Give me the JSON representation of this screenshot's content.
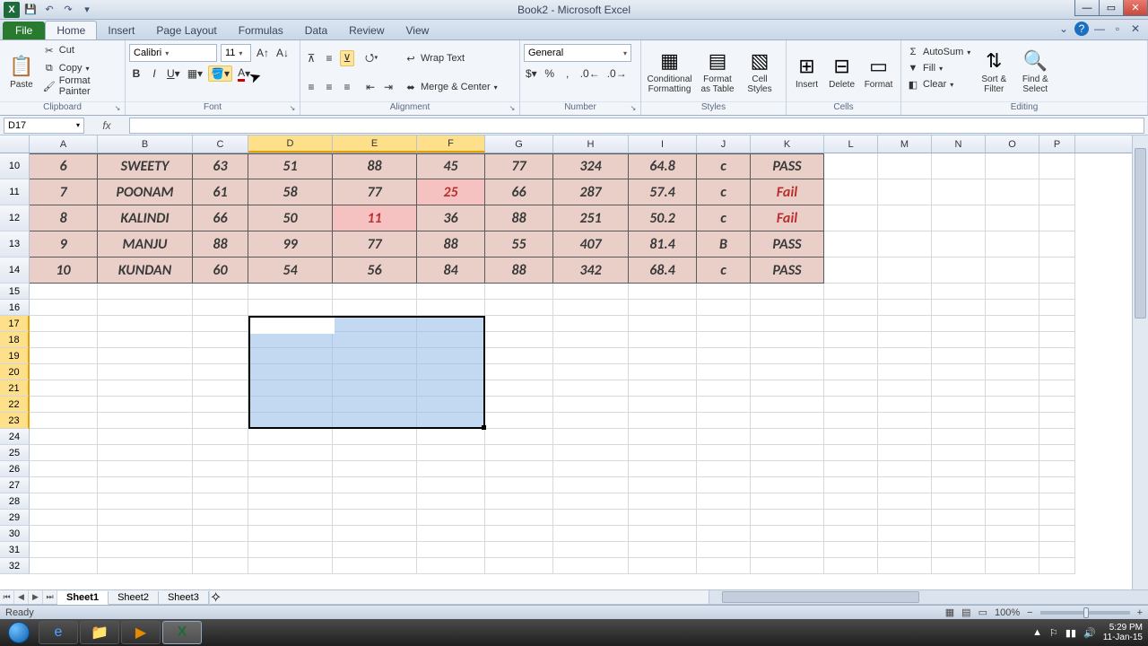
{
  "window": {
    "title": "Book2 - Microsoft Excel"
  },
  "tabs": [
    "File",
    "Home",
    "Insert",
    "Page Layout",
    "Formulas",
    "Data",
    "Review",
    "View"
  ],
  "active_tab": "Home",
  "ribbon": {
    "clipboard": {
      "paste": "Paste",
      "cut": "Cut",
      "copy": "Copy",
      "fp": "Format Painter",
      "label": "Clipboard"
    },
    "font": {
      "name": "Calibri",
      "size": "11",
      "label": "Font"
    },
    "alignment": {
      "wrap": "Wrap Text",
      "merge": "Merge & Center",
      "label": "Alignment"
    },
    "number": {
      "format": "General",
      "label": "Number"
    },
    "styles": {
      "cf": "Conditional Formatting",
      "fat": "Format as Table",
      "cs": "Cell Styles",
      "label": "Styles"
    },
    "cells": {
      "ins": "Insert",
      "del": "Delete",
      "fmt": "Format",
      "label": "Cells"
    },
    "editing": {
      "sum": "AutoSum",
      "fill": "Fill",
      "clear": "Clear",
      "sort": "Sort & Filter",
      "find": "Find & Select",
      "label": "Editing"
    }
  },
  "name_box": "D17",
  "col_widths": {
    "A": 76,
    "B": 106,
    "C": 62,
    "D": 94,
    "E": 94,
    "F": 76,
    "G": 76,
    "H": 84,
    "I": 76,
    "J": 60,
    "K": 82,
    "L": 60,
    "M": 60,
    "N": 60,
    "O": 60,
    "P": 40
  },
  "columns": [
    "A",
    "B",
    "C",
    "D",
    "E",
    "F",
    "G",
    "H",
    "I",
    "J",
    "K",
    "L",
    "M",
    "N",
    "O",
    "P"
  ],
  "selected_cols": [
    "D",
    "E",
    "F"
  ],
  "rows_data": [
    {
      "n": "10",
      "r": 6,
      "cells": [
        "6",
        "SWEETY",
        "63",
        "51",
        "88",
        "45",
        "77",
        "324",
        "64.8",
        "c",
        "PASS"
      ]
    },
    {
      "n": "11",
      "r": 7,
      "cells": [
        "7",
        "POONAM",
        "61",
        "58",
        "77",
        "25",
        "66",
        "287",
        "57.4",
        "c",
        "Fail"
      ],
      "lowcols": [
        5
      ],
      "failcol": 10
    },
    {
      "n": "12",
      "r": 8,
      "cells": [
        "8",
        "KALINDI",
        "66",
        "50",
        "11",
        "36",
        "88",
        "251",
        "50.2",
        "c",
        "Fail"
      ],
      "lowcols": [
        4
      ],
      "failcol": 10
    },
    {
      "n": "13",
      "r": 9,
      "cells": [
        "9",
        "MANJU",
        "88",
        "99",
        "77",
        "88",
        "55",
        "407",
        "81.4",
        "B",
        "PASS"
      ]
    },
    {
      "n": "14",
      "r": 10,
      "cells": [
        "10",
        "KUNDAN",
        "60",
        "54",
        "56",
        "84",
        "88",
        "342",
        "68.4",
        "c",
        "PASS"
      ]
    }
  ],
  "empty_rows": [
    "15",
    "16",
    "17",
    "18",
    "19",
    "20",
    "21",
    "22",
    "23",
    "24",
    "25",
    "26",
    "27",
    "28",
    "29",
    "30",
    "31",
    "32"
  ],
  "selected_rows_header": [
    "17",
    "18",
    "19",
    "20",
    "21",
    "22",
    "23"
  ],
  "selection": {
    "ref": "D17:F23"
  },
  "sheets": [
    "Sheet1",
    "Sheet2",
    "Sheet3"
  ],
  "active_sheet": "Sheet1",
  "status": {
    "ready": "Ready",
    "zoom": "100%"
  },
  "system": {
    "time": "5:29 PM",
    "date": "11-Jan-15"
  }
}
